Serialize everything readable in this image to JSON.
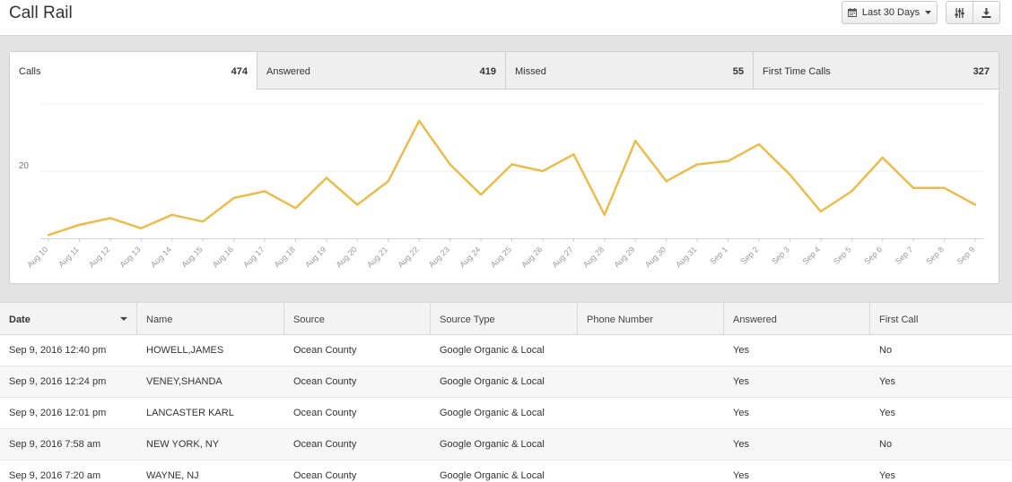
{
  "header": {
    "title": "Call Rail",
    "date_range_label": "Last 30 Days",
    "calendar_icon": "calendar-icon",
    "filter_icon": "sliders-icon",
    "download_icon": "download-icon"
  },
  "tabs": [
    {
      "label": "Calls",
      "count": "474"
    },
    {
      "label": "Answered",
      "count": "419"
    },
    {
      "label": "Missed",
      "count": "55"
    },
    {
      "label": "First Time Calls",
      "count": "327"
    }
  ],
  "chart_data": {
    "type": "line",
    "title": "",
    "xlabel": "",
    "ylabel": "",
    "y_tick_labels": [
      "20"
    ],
    "ylim": [
      0,
      40
    ],
    "grid": true,
    "color": "#e8bd50",
    "categories": [
      "Aug 10",
      "Aug 11",
      "Aug 12",
      "Aug 13",
      "Aug 14",
      "Aug 15",
      "Aug 16",
      "Aug 17",
      "Aug 18",
      "Aug 19",
      "Aug 20",
      "Aug 21",
      "Aug 22",
      "Aug 23",
      "Aug 24",
      "Aug 25",
      "Aug 26",
      "Aug 27",
      "Aug 28",
      "Aug 29",
      "Aug 30",
      "Aug 31",
      "Sep 1",
      "Sep 2",
      "Sep 3",
      "Sep 4",
      "Sep 5",
      "Sep 6",
      "Sep 7",
      "Sep 8",
      "Sep 9"
    ],
    "series": [
      {
        "values": [
          1,
          4,
          6,
          3,
          7,
          5,
          12,
          14,
          9,
          18,
          10,
          17,
          35,
          22,
          13,
          22,
          20,
          25,
          7,
          29,
          17,
          22,
          23,
          28,
          19,
          8,
          14,
          24,
          15,
          15,
          10
        ]
      }
    ]
  },
  "table": {
    "sort_column": "Date",
    "columns": [
      "Date",
      "Name",
      "Source",
      "Source Type",
      "Phone Number",
      "Answered",
      "First Call"
    ],
    "rows": [
      [
        "Sep 9, 2016 12:40 pm",
        "HOWELL,JAMES",
        "Ocean County",
        "Google Organic & Local",
        "",
        "Yes",
        "No"
      ],
      [
        "Sep 9, 2016 12:24 pm",
        "VENEY,SHANDA",
        "Ocean County",
        "Google Organic & Local",
        "",
        "Yes",
        "Yes"
      ],
      [
        "Sep 9, 2016 12:01 pm",
        "LANCASTER KARL",
        "Ocean County",
        "Google Organic & Local",
        "",
        "Yes",
        "Yes"
      ],
      [
        "Sep 9, 2016 7:58 am",
        "NEW YORK, NY",
        "Ocean County",
        "Google Organic & Local",
        "",
        "Yes",
        "No"
      ],
      [
        "Sep 9, 2016 7:20 am",
        "WAYNE, NJ",
        "Ocean County",
        "Google Organic & Local",
        "",
        "Yes",
        "Yes"
      ]
    ]
  }
}
